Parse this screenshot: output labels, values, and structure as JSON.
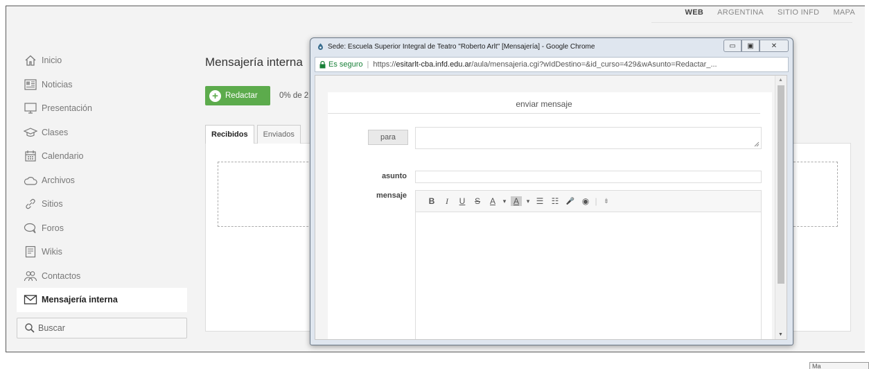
{
  "topnav": [
    "WEB",
    "ARGENTINA",
    "SITIO INFD",
    "MAPA"
  ],
  "sidebar": {
    "items": [
      {
        "label": "Inicio",
        "icon": "home-icon"
      },
      {
        "label": "Noticias",
        "icon": "news-icon"
      },
      {
        "label": "Presentación",
        "icon": "monitor-icon"
      },
      {
        "label": "Clases",
        "icon": "graduation-cap-icon"
      },
      {
        "label": "Calendario",
        "icon": "calendar-icon"
      },
      {
        "label": "Archivos",
        "icon": "cloud-icon"
      },
      {
        "label": "Sitios",
        "icon": "link-icon"
      },
      {
        "label": "Foros",
        "icon": "chat-icon"
      },
      {
        "label": "Wikis",
        "icon": "document-icon"
      },
      {
        "label": "Contactos",
        "icon": "people-icon"
      },
      {
        "label": "Mensajería interna",
        "icon": "envelope-icon"
      }
    ],
    "search_label": "Buscar"
  },
  "main": {
    "title": "Mensajería interna",
    "compose_label": "Redactar",
    "usage_text": "0% de 2",
    "tabs": [
      "Recibidos",
      "Enviados"
    ],
    "corner_text": "Ma"
  },
  "popup": {
    "title": "Sede: Escuela Superior Integral de Teatro \"Roberto Arlt\" [Mensajería] - Google Chrome",
    "secure_label": "Es seguro",
    "url_scheme": "https://",
    "url_host": "esitarlt-cba.infd.edu.ar",
    "url_path": "/aula/mensajeria.cgi?wIdDestino=&id_curso=429&wAsunto=Redactar_...",
    "form": {
      "heading": "enviar mensaje",
      "to_button": "para",
      "subject_label": "asunto",
      "message_label": "mensaje"
    },
    "toolbar": {
      "bold": "B",
      "italic": "I",
      "underline": "U",
      "strike": "S",
      "font_color": "A",
      "bg_color": "A",
      "caret": "▾",
      "bullets": "☰",
      "numbered": "☷",
      "mic": "🎤",
      "preview": "◉",
      "more": "⇟"
    }
  },
  "colors": {
    "accent_green": "#5cab4c",
    "secure_green": "#188038"
  }
}
